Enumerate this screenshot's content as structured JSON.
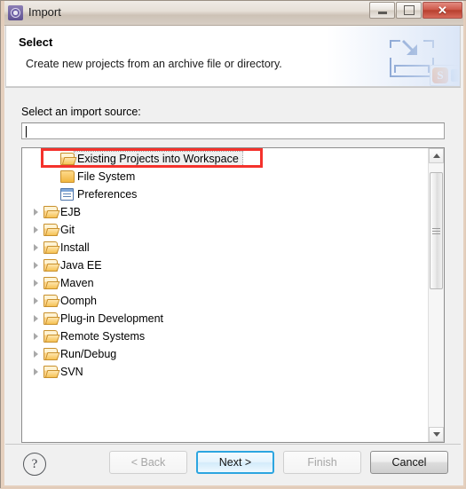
{
  "window": {
    "title": "Import",
    "icon": "eclipse-gear-icon",
    "controls": {
      "minimize": "–",
      "maximize": "□",
      "close": "✕"
    }
  },
  "header": {
    "title": "Select",
    "subtitle": "Create new projects from an archive file or directory.",
    "banner_icon": "import-arrow-icon",
    "ime_badge": "S"
  },
  "main": {
    "source_label": "Select an import source:",
    "filter": {
      "value": "",
      "placeholder": ""
    },
    "tree": [
      {
        "label": "Existing Projects into Workspace",
        "icon": "folder-open-icon",
        "level": 1,
        "expandable": false,
        "selected": true
      },
      {
        "label": "File System",
        "icon": "folder-closed-icon",
        "level": 1,
        "expandable": false,
        "selected": false
      },
      {
        "label": "Preferences",
        "icon": "preferences-icon",
        "level": 1,
        "expandable": false,
        "selected": false
      },
      {
        "label": "EJB",
        "icon": "folder-open-icon",
        "level": 0,
        "expandable": true,
        "selected": false
      },
      {
        "label": "Git",
        "icon": "folder-open-icon",
        "level": 0,
        "expandable": true,
        "selected": false
      },
      {
        "label": "Install",
        "icon": "folder-open-icon",
        "level": 0,
        "expandable": true,
        "selected": false
      },
      {
        "label": "Java EE",
        "icon": "folder-open-icon",
        "level": 0,
        "expandable": true,
        "selected": false
      },
      {
        "label": "Maven",
        "icon": "folder-open-icon",
        "level": 0,
        "expandable": true,
        "selected": false
      },
      {
        "label": "Oomph",
        "icon": "folder-open-icon",
        "level": 0,
        "expandable": true,
        "selected": false
      },
      {
        "label": "Plug-in Development",
        "icon": "folder-open-icon",
        "level": 0,
        "expandable": true,
        "selected": false
      },
      {
        "label": "Remote Systems",
        "icon": "folder-open-icon",
        "level": 0,
        "expandable": true,
        "selected": false
      },
      {
        "label": "Run/Debug",
        "icon": "folder-open-icon",
        "level": 0,
        "expandable": true,
        "selected": false
      },
      {
        "label": "SVN",
        "icon": "folder-open-icon",
        "level": 0,
        "expandable": true,
        "selected": false
      }
    ],
    "annotation": {
      "color": "#f4322c",
      "target": "Existing Projects into Workspace"
    }
  },
  "footer": {
    "help_label": "?",
    "buttons": [
      {
        "label": "< Back",
        "state": "disabled"
      },
      {
        "label": "Next >",
        "state": "default"
      },
      {
        "label": "Finish",
        "state": "disabled"
      },
      {
        "label": "Cancel",
        "state": "normal"
      }
    ]
  }
}
